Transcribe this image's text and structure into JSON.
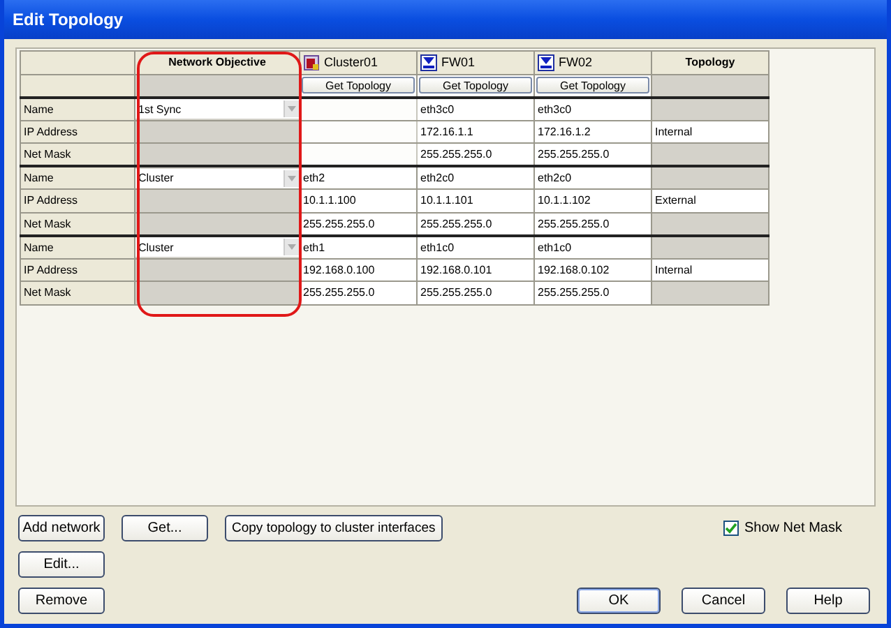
{
  "window": {
    "title": "Edit Topology"
  },
  "table": {
    "objective_header": "Network Objective",
    "topology_header": "Topology",
    "devices": [
      {
        "name": "Cluster01",
        "kind": "cluster",
        "button": "Get Topology"
      },
      {
        "name": "FW01",
        "kind": "firewall",
        "button": "Get Topology"
      },
      {
        "name": "FW02",
        "kind": "firewall",
        "button": "Get Topology"
      }
    ],
    "networks": [
      {
        "labels": [
          "Name",
          "IP Address",
          "Net Mask"
        ],
        "objective": "1st Sync",
        "topology": "Internal",
        "interfaces": [
          {
            "kind": "unassigned"
          },
          {
            "name": "eth3c0",
            "ip": "172.16.1.1",
            "mask": "255.255.255.0"
          },
          {
            "name": "eth3c0",
            "ip": "172.16.1.2",
            "mask": "255.255.255.0"
          }
        ]
      },
      {
        "labels": [
          "Name",
          "IP Address",
          "Net Mask"
        ],
        "objective": "Cluster",
        "topology": "External",
        "interfaces": [
          {
            "name": "eth2",
            "ip": "10.1.1.100",
            "mask": "255.255.255.0"
          },
          {
            "name": "eth2c0",
            "ip": "10.1.1.101",
            "mask": "255.255.255.0"
          },
          {
            "name": "eth2c0",
            "ip": "10.1.1.102",
            "mask": "255.255.255.0"
          }
        ]
      },
      {
        "labels": [
          "Name",
          "IP Address",
          "Net Mask"
        ],
        "objective": "Cluster",
        "topology": "Internal",
        "interfaces": [
          {
            "name": "eth1",
            "ip": "192.168.0.100",
            "mask": "255.255.255.0"
          },
          {
            "name": "eth1c0",
            "ip": "192.168.0.101",
            "mask": "255.255.255.0"
          },
          {
            "name": "eth1c0",
            "ip": "192.168.0.102",
            "mask": "255.255.255.0"
          }
        ]
      }
    ]
  },
  "left_buttons": [
    [
      "Add network",
      "Get...",
      "Copy topology to cluster interfaces"
    ],
    [
      "Edit..."
    ],
    [
      "Remove"
    ]
  ],
  "show_net_mask": {
    "label": "Show Net Mask",
    "checked": true
  },
  "dialog_buttons": [
    {
      "label": "OK",
      "default": true
    },
    {
      "label": "Cancel",
      "default": false
    },
    {
      "label": "Help",
      "default": false
    }
  ]
}
